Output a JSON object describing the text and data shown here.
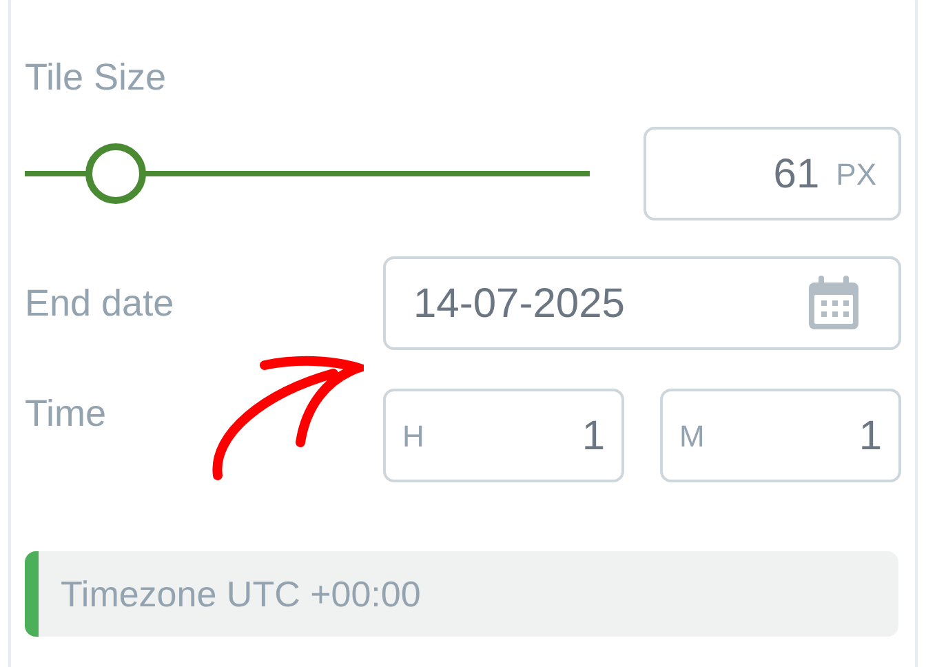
{
  "tile_size": {
    "label": "Tile Size",
    "level": 0.16,
    "value": "61",
    "unit": "PX"
  },
  "end_date": {
    "label": "End date",
    "value": "14-07-2025"
  },
  "time": {
    "label": "Time",
    "hour": {
      "prefix": "H",
      "value": "1"
    },
    "minute": {
      "prefix": "M",
      "value": "1"
    }
  },
  "timezone_note": "Timezone UTC +00:00"
}
